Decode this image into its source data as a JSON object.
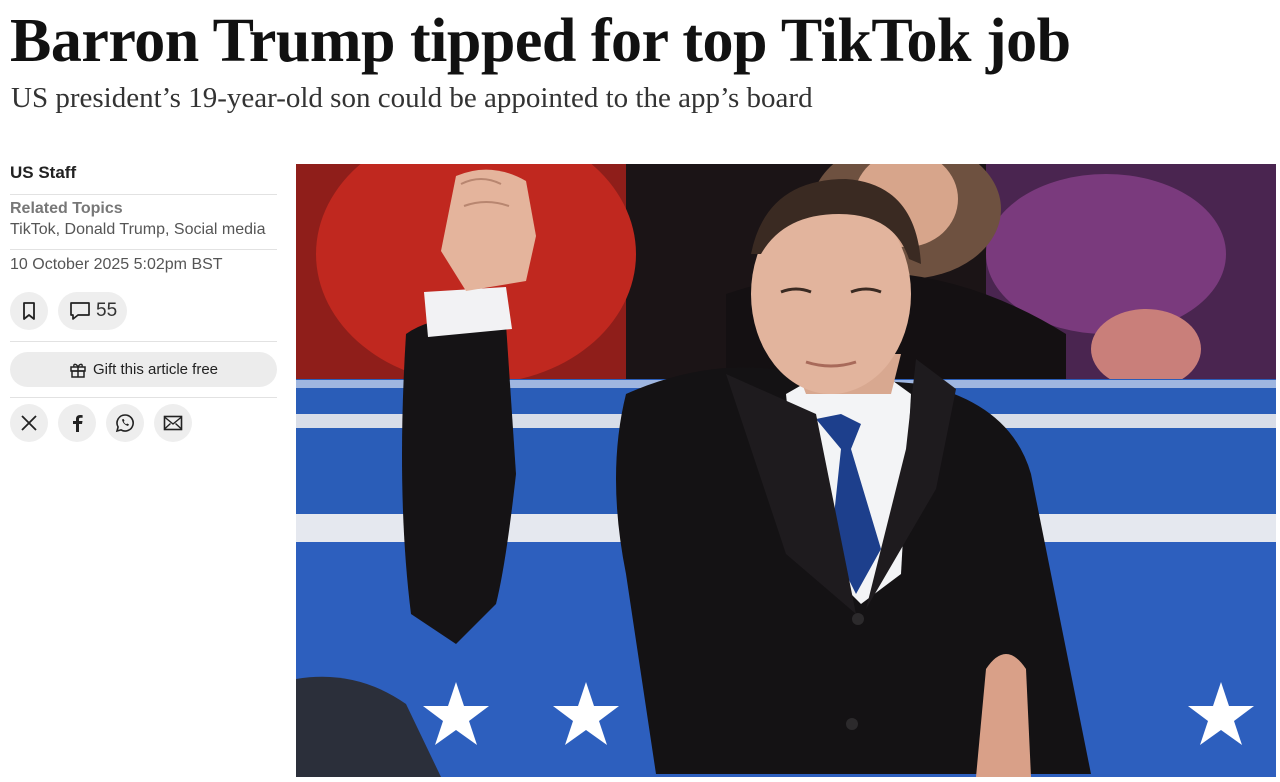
{
  "article": {
    "headline": "Barron Trump tipped for top TikTok job",
    "standfirst": "US president’s 19-year-old son could be appointed to the app’s board",
    "author": "US Staff",
    "related_topics_label": "Related Topics",
    "related_topics": "TikTok, Donald Trump, Social media",
    "date": "10 October 2025 5:02pm BST",
    "comment_count": "55",
    "gift_label": "Gift this article free"
  },
  "icons": {
    "save": "bookmark-icon",
    "comments": "comment-bubble-icon",
    "gift": "gift-icon",
    "share": [
      "x-logo-icon",
      "facebook-icon",
      "whatsapp-icon",
      "email-icon"
    ]
  },
  "colors": {
    "headline": "#111111",
    "button_bg": "#eeeeee",
    "photo_blue": "#2a5db8",
    "photo_red": "#c0281f"
  }
}
